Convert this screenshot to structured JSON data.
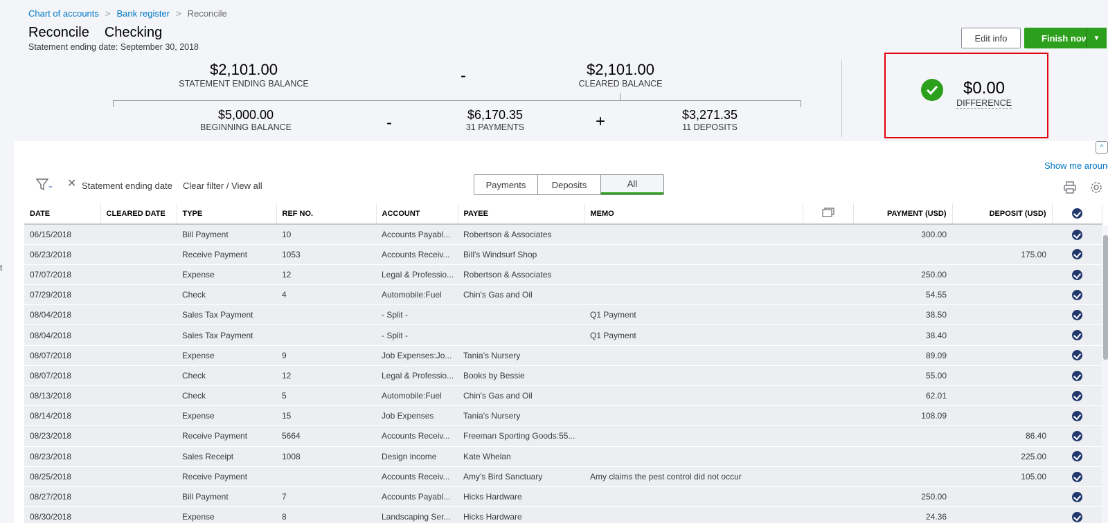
{
  "breadcrumb": {
    "items": [
      "Chart of accounts",
      "Bank register"
    ],
    "current": "Reconcile",
    "separator": ">"
  },
  "header": {
    "title": "Reconcile",
    "account": "Checking",
    "statement_date": "Statement ending date: September 30, 2018",
    "edit_label": "Edit info",
    "finish_label": "Finish now"
  },
  "summary": {
    "statement_ending_balance": "$2,101.00",
    "statement_ending_label": "STATEMENT ENDING BALANCE",
    "minus": "-",
    "cleared_balance": "$2,101.00",
    "cleared_label": "CLEARED BALANCE",
    "beginning_balance": "$5,000.00",
    "beginning_label": "BEGINNING BALANCE",
    "payments_total": "$6,170.35",
    "payments_label": "31 PAYMENTS",
    "plus": "+",
    "deposits_total": "$3,271.35",
    "deposits_label": "11 DEPOSITS",
    "difference": "$0.00",
    "difference_label": "DIFFERENCE"
  },
  "toolbar": {
    "show_me": "Show me around",
    "filter_label": "Statement ending date",
    "clear_filter": "Clear filter / View all",
    "tabs": [
      "Payments",
      "Deposits",
      "All"
    ],
    "active_tab": "All"
  },
  "left_edge_text": "t",
  "table": {
    "columns": [
      "DATE",
      "CLEARED DATE",
      "TYPE",
      "REF NO.",
      "ACCOUNT",
      "PAYEE",
      "MEMO",
      "",
      "PAYMENT (USD)",
      "DEPOSIT (USD)"
    ],
    "rows": [
      {
        "date": "06/15/2018",
        "cleared": "",
        "type": "Bill Payment",
        "ref": "10",
        "account": "Accounts Payabl...",
        "payee": "Robertson & Associates",
        "memo": "",
        "payment": "300.00",
        "deposit": ""
      },
      {
        "date": "06/23/2018",
        "cleared": "",
        "type": "Receive Payment",
        "ref": "1053",
        "account": "Accounts Receiv...",
        "payee": "Bill's Windsurf Shop",
        "memo": "",
        "payment": "",
        "deposit": "175.00"
      },
      {
        "date": "07/07/2018",
        "cleared": "",
        "type": "Expense",
        "ref": "12",
        "account": "Legal & Professio...",
        "payee": "Robertson & Associates",
        "memo": "",
        "payment": "250.00",
        "deposit": ""
      },
      {
        "date": "07/29/2018",
        "cleared": "",
        "type": "Check",
        "ref": "4",
        "account": "Automobile:Fuel",
        "payee": "Chin's Gas and Oil",
        "memo": "",
        "payment": "54.55",
        "deposit": ""
      },
      {
        "date": "08/04/2018",
        "cleared": "",
        "type": "Sales Tax Payment",
        "ref": "",
        "account": "- Split -",
        "payee": "",
        "memo": "Q1 Payment",
        "payment": "38.50",
        "deposit": ""
      },
      {
        "date": "08/04/2018",
        "cleared": "",
        "type": "Sales Tax Payment",
        "ref": "",
        "account": "- Split -",
        "payee": "",
        "memo": "Q1 Payment",
        "payment": "38.40",
        "deposit": ""
      },
      {
        "date": "08/07/2018",
        "cleared": "",
        "type": "Expense",
        "ref": "9",
        "account": "Job Expenses:Jo...",
        "payee": "Tania's Nursery",
        "memo": "",
        "payment": "89.09",
        "deposit": ""
      },
      {
        "date": "08/07/2018",
        "cleared": "",
        "type": "Check",
        "ref": "12",
        "account": "Legal & Professio...",
        "payee": "Books by Bessie",
        "memo": "",
        "payment": "55.00",
        "deposit": ""
      },
      {
        "date": "08/13/2018",
        "cleared": "",
        "type": "Check",
        "ref": "5",
        "account": "Automobile:Fuel",
        "payee": "Chin's Gas and Oil",
        "memo": "",
        "payment": "62.01",
        "deposit": ""
      },
      {
        "date": "08/14/2018",
        "cleared": "",
        "type": "Expense",
        "ref": "15",
        "account": "Job Expenses",
        "payee": "Tania's Nursery",
        "memo": "",
        "payment": "108.09",
        "deposit": ""
      },
      {
        "date": "08/23/2018",
        "cleared": "",
        "type": "Receive Payment",
        "ref": "5664",
        "account": "Accounts Receiv...",
        "payee": "Freeman Sporting Goods:55...",
        "memo": "",
        "payment": "",
        "deposit": "86.40"
      },
      {
        "date": "08/23/2018",
        "cleared": "",
        "type": "Sales Receipt",
        "ref": "1008",
        "account": "Design income",
        "payee": "Kate Whelan",
        "memo": "",
        "payment": "",
        "deposit": "225.00"
      },
      {
        "date": "08/25/2018",
        "cleared": "",
        "type": "Receive Payment",
        "ref": "",
        "account": "Accounts Receiv...",
        "payee": "Amy's Bird Sanctuary",
        "memo": "Amy claims the pest control did not occur",
        "payment": "",
        "deposit": "105.00"
      },
      {
        "date": "08/27/2018",
        "cleared": "",
        "type": "Bill Payment",
        "ref": "7",
        "account": "Accounts Payabl...",
        "payee": "Hicks Hardware",
        "memo": "",
        "payment": "250.00",
        "deposit": ""
      },
      {
        "date": "08/30/2018",
        "cleared": "",
        "type": "Expense",
        "ref": "8",
        "account": "Landscaping Ser...",
        "payee": "Hicks Hardware",
        "memo": "",
        "payment": "24.36",
        "deposit": ""
      }
    ]
  },
  "colors": {
    "accent_green": "#2ca01c",
    "link_blue": "#0077c5",
    "highlight_red": "#e3000f",
    "check_navy": "#21386d"
  }
}
